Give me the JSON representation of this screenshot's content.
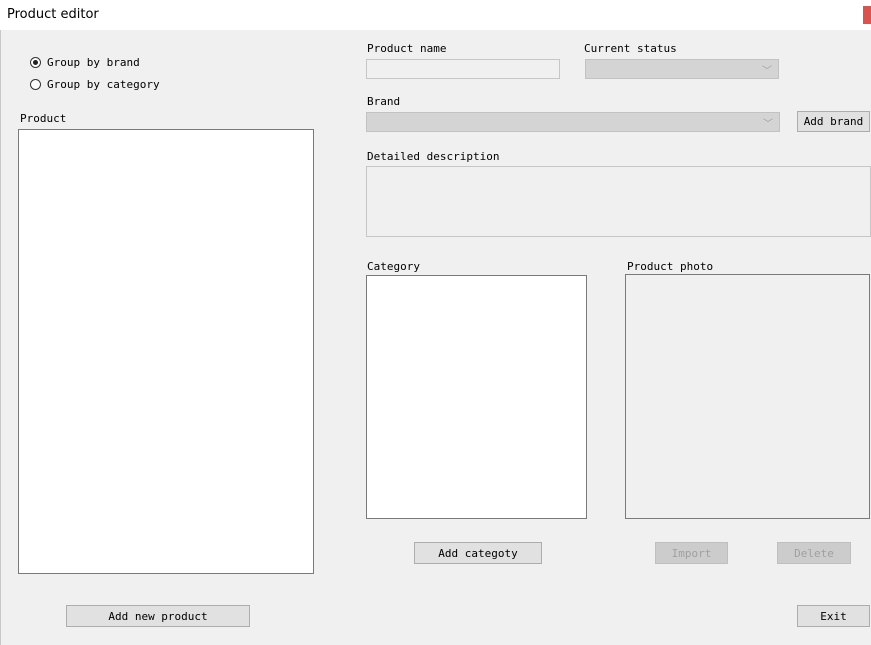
{
  "window": {
    "title": "Product editor"
  },
  "grouping": {
    "option_brand": "Group by brand",
    "option_category": "Group by category",
    "selected": "brand"
  },
  "product": {
    "label": "Product",
    "add_button": "Add new product"
  },
  "fields": {
    "product_name_label": "Product name",
    "product_name_value": "",
    "status_label": "Current status",
    "status_value": "",
    "brand_label": "Brand",
    "brand_value": "",
    "add_brand_button": "Add brand",
    "description_label": "Detailed description",
    "description_value": ""
  },
  "category": {
    "label": "Category",
    "add_button": "Add categoty"
  },
  "photo": {
    "label": "Product photo",
    "import_button": "Import",
    "delete_button": "Delete"
  },
  "footer": {
    "exit_button": "Exit"
  },
  "colors": {
    "close_button": "#d9534f",
    "combo_fill": "#d4d4d4"
  },
  "icons": {
    "dropdown": "chevron-down-icon"
  }
}
